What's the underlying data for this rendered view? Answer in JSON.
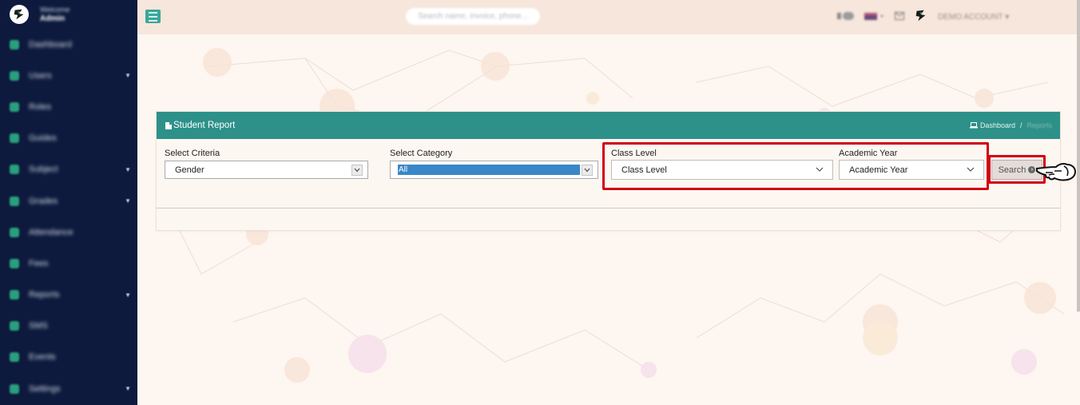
{
  "sidebar": {
    "welcome": "Welcome",
    "user": "Admin",
    "items": [
      {
        "label": "Dashboard",
        "caret": false
      },
      {
        "label": "Users",
        "caret": true
      },
      {
        "label": "Roles",
        "caret": false
      },
      {
        "label": "Guides",
        "caret": false
      },
      {
        "label": "Subject",
        "caret": true
      },
      {
        "label": "Grades",
        "caret": true
      },
      {
        "label": "Attendance",
        "caret": false
      },
      {
        "label": "Fees",
        "caret": false
      },
      {
        "label": "Reports",
        "caret": true
      },
      {
        "label": "SMS",
        "caret": false
      },
      {
        "label": "Events",
        "caret": false
      },
      {
        "label": "Settings",
        "caret": true
      }
    ]
  },
  "topbar": {
    "search_placeholder": "Search name, invoice, phone...",
    "account_label": "DEMO ACCOUNT"
  },
  "card": {
    "title": "Student Report",
    "breadcrumb_home": "Dashboard",
    "breadcrumb_sep": "/",
    "breadcrumb_current": "Reports"
  },
  "form": {
    "criteria_label": "Select Criteria",
    "criteria_value": "Gender",
    "category_label": "Select Category",
    "category_value": "All",
    "class_label": "Class Level",
    "class_value": "Class Level",
    "year_label": "Academic Year",
    "year_value": "Academic Year",
    "search_label": "Search"
  },
  "colors": {
    "sidebar": "#0d1a3d",
    "header_teal": "#2d9189",
    "highlight_red": "#d00012"
  }
}
